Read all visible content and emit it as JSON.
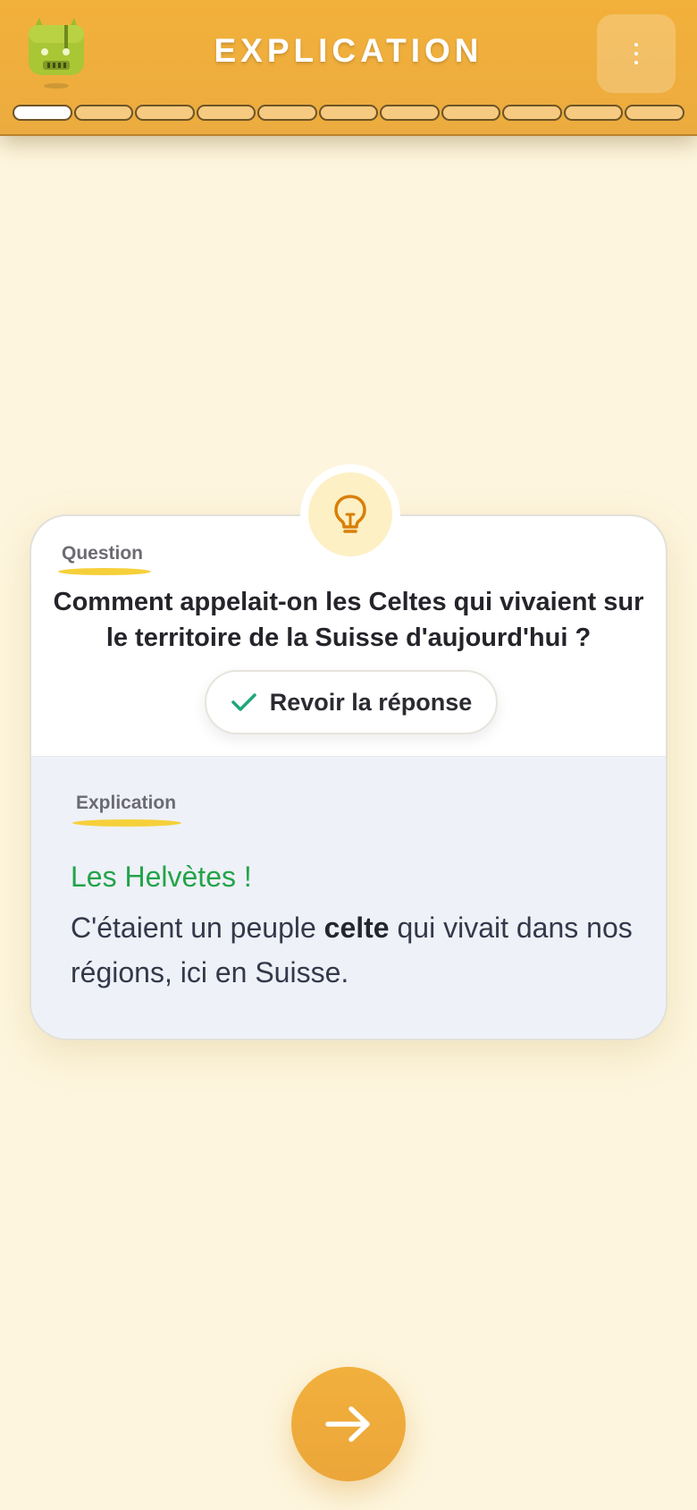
{
  "header": {
    "title": "EXPLICATION",
    "mascot_icon": "robot-mascot-icon",
    "menu_icon": "vertical-dots-icon",
    "progress": {
      "total_segments": 11,
      "completed_segments": 1
    }
  },
  "card": {
    "icon": "lightbulb-icon",
    "question_label": "Question",
    "question_text": "Comment appelait-on les Celtes qui vivaient sur le territoire de la Suisse d'aujourd'hui ?",
    "review_button": {
      "label": "Revoir la réponse",
      "icon": "check-icon"
    },
    "explanation_label": "Explication",
    "answer": "Les Helvètes !",
    "explanation": {
      "before": "C'étaient un peuple ",
      "bold": "celte",
      "after": " qui vivait dans nos régions, ici en Suisse."
    }
  },
  "next_button": {
    "icon": "arrow-right-icon"
  },
  "colors": {
    "background": "#fdf5dd",
    "header": "#f2b13a",
    "accent_yellow": "#f6d03a",
    "answer_green": "#23a34a",
    "check_green": "#1fa67a"
  }
}
